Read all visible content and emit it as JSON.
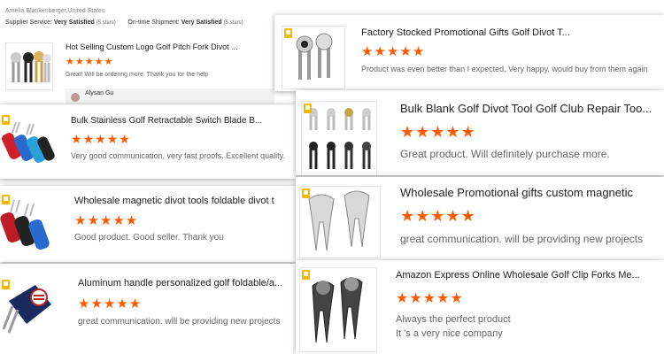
{
  "header": {
    "reviewer": "Amelia Blankenberger,United States",
    "supplier_service_label": "Supplier Service:",
    "supplier_service_value": "Very Satisfied",
    "supplier_service_stars": "(5 stars)",
    "shipment_label": "On-time Shipment:",
    "shipment_value": "Very Satisfied",
    "shipment_stars": "(5 stars)"
  },
  "reply": {
    "name": "Alysan Gu"
  },
  "stars_text": "★★★★★",
  "reviews": [
    {
      "title": "Hot Selling Custom Logo Golf Pitch Fork Divot ...",
      "review": "Great! Will be ordering more. Thank you for the help"
    },
    {
      "title": "Factory Stocked Promotional Gifts Golf Divot T...",
      "review": "Product was even better than I expected. Very happy, would buy from them again"
    },
    {
      "title": "Bulk Stainless Golf Retractable Switch Blade B...",
      "review": "Very good communication, very fast proofs. Excellent quality."
    },
    {
      "title": "Bulk Blank Golf Divot Tool Golf Club Repair Too...",
      "review": "Great product.  Will definitely purchase more."
    },
    {
      "title": "Wholesale magnetic divot tools foldable divot t",
      "review": "Good product. Good seller. Thank you"
    },
    {
      "title": "Wholesale Promotional gifts custom magnetic",
      "review": "great communication. will be providing new projects"
    },
    {
      "title": "Aluminum handle personalized golf foldable/a...",
      "review": "great communication. will be providing new projects"
    },
    {
      "title": "Amazon Express Online Wholesale Golf Clip Forks Me...",
      "review": "Always the perfect product",
      "review2": "It 's a very nice company"
    }
  ]
}
